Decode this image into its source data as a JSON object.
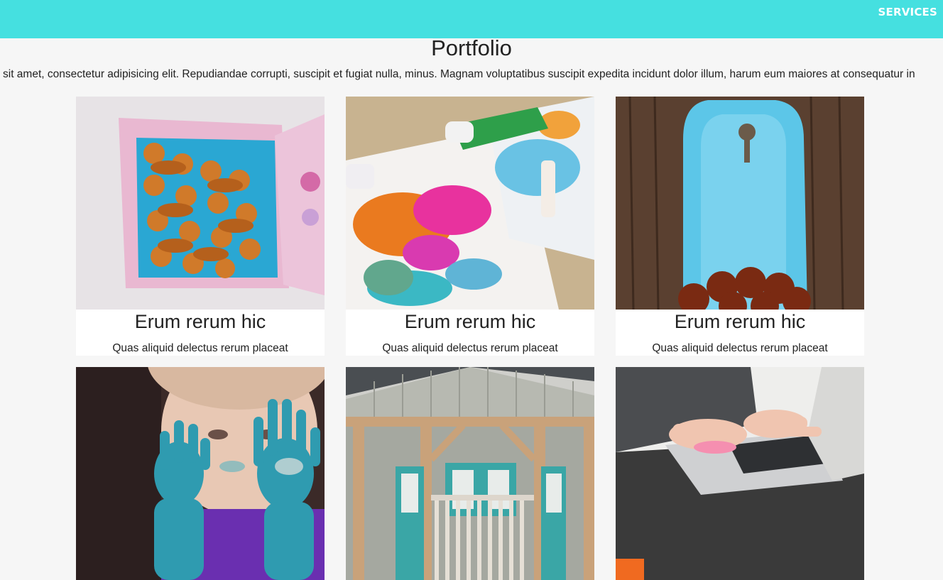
{
  "nav": {
    "services_label": "SERVICES"
  },
  "portfolio": {
    "title": "Portfolio",
    "intro": "sit amet, consectetur adipisicing elit. Repudiandae corrupti, suscipit et fugiat nulla, minus. Magnam voluptatibus suscipit expedita incidunt dolor illum, harum eum maiores at consequatur in",
    "items": [
      {
        "title": "Erum rerum hic",
        "subtitle": "Quas aliquid delectus rerum placeat",
        "image": "gingerbread-cookies-box"
      },
      {
        "title": "Erum rerum hic",
        "subtitle": "Quas aliquid delectus rerum placeat",
        "image": "paint-splatter-paper"
      },
      {
        "title": "Erum rerum hic",
        "subtitle": "Quas aliquid delectus rerum placeat",
        "image": "blue-fountain-chestnuts"
      },
      {
        "image": "child-painted-hands"
      },
      {
        "image": "wooden-house-porch"
      },
      {
        "image": "laptop-typing"
      }
    ]
  },
  "colors": {
    "topbar": "#45e0e0",
    "background": "#f6f6f6"
  }
}
